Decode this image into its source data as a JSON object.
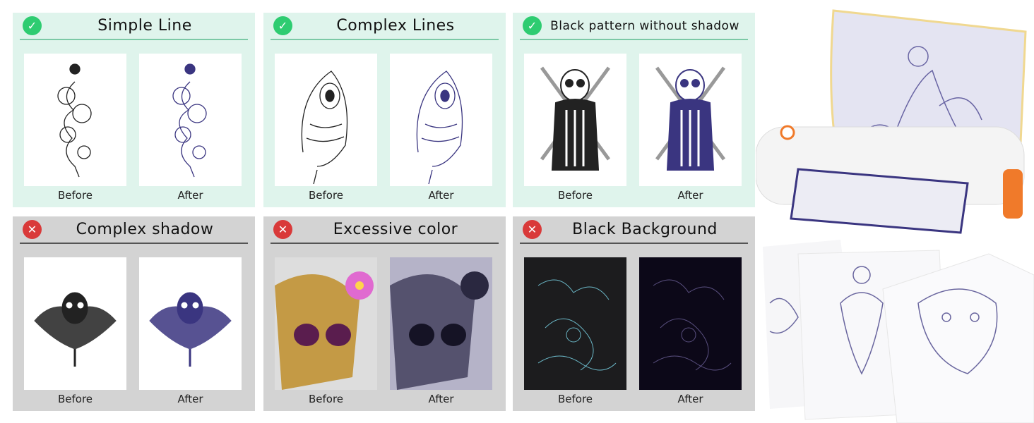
{
  "panels": [
    {
      "status": "good",
      "title": "Simple Line",
      "before": "Before",
      "after": "After"
    },
    {
      "status": "good",
      "title": "Complex Lines",
      "before": "Before",
      "after": "After"
    },
    {
      "status": "good",
      "title": "Black pattern without shadow",
      "before": "Before",
      "after": "After"
    },
    {
      "status": "bad",
      "title": "Complex shadow",
      "before": "Before",
      "after": "After"
    },
    {
      "status": "bad",
      "title": "Excessive color",
      "before": "Before",
      "after": "After"
    },
    {
      "status": "bad",
      "title": "Black Background",
      "before": "Before",
      "after": "After"
    }
  ],
  "icons": {
    "good": "check-circle-icon",
    "bad": "x-circle-icon"
  },
  "colors": {
    "good_bg": "#dff4ec",
    "bad_bg": "#d3d3d3",
    "check": "#2ecc71",
    "cross": "#d93a3a",
    "stencil_ink": "#3a3580",
    "printer_accent": "#f07a2a"
  }
}
